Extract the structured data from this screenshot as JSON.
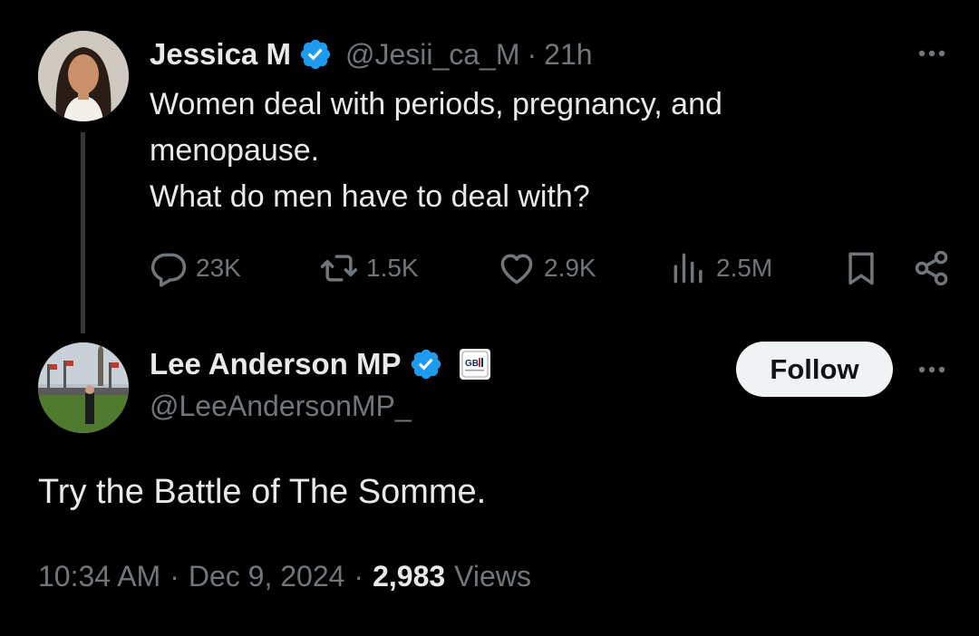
{
  "colors": {
    "background": "#000000",
    "text_primary": "#e7e9ea",
    "text_secondary": "#71767b",
    "verified_blue": "#1d9bf0",
    "follow_button_bg": "#eff3f4"
  },
  "original_tweet": {
    "author_name": "Jessica M",
    "handle": "@Jesii_ca_M",
    "separator": "·",
    "time_ago": "21h",
    "verified": true,
    "text_lines": [
      "Women deal with periods, pregnancy, and",
      "menopause.",
      "What do men have to deal with?"
    ],
    "stats": {
      "replies": "23K",
      "reposts": "1.5K",
      "likes": "2.9K",
      "views": "2.5M"
    },
    "icons": [
      "reply-icon",
      "repost-icon",
      "like-icon",
      "views-icon",
      "bookmark-icon",
      "share-icon",
      "more-icon"
    ]
  },
  "reply_tweet": {
    "author_name": "Lee Anderson MP",
    "handle": "@LeeAndersonMP_",
    "verified": true,
    "affiliate_badge": "GB News",
    "follow_label": "Follow",
    "text": "Try the Battle of The Somme.",
    "timestamp": "10:34 AM",
    "separator": "·",
    "date": "Dec 9, 2024",
    "views_count": "2,983",
    "views_label": "Views"
  }
}
